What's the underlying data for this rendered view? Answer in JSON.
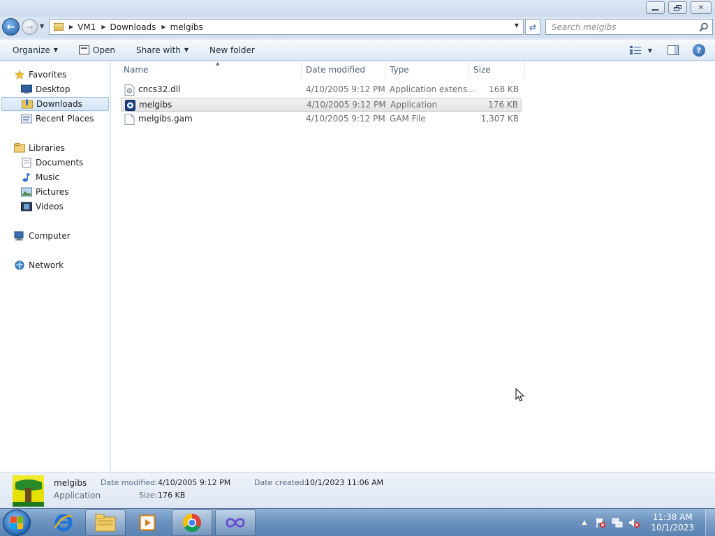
{
  "window": {
    "minimize_glyph": "▭",
    "maximize_glyph": "❐",
    "close_glyph": "✕"
  },
  "address": {
    "crumbs": [
      "VM1",
      "Downloads",
      "melgibs"
    ]
  },
  "search": {
    "placeholder": "Search melgibs"
  },
  "toolbar": {
    "organize": "Organize",
    "open": "Open",
    "share_with": "Share with",
    "new_folder": "New folder"
  },
  "nav": {
    "favorites": "Favorites",
    "desktop": "Desktop",
    "downloads": "Downloads",
    "recent_places": "Recent Places",
    "libraries": "Libraries",
    "documents": "Documents",
    "music": "Music",
    "pictures": "Pictures",
    "videos": "Videos",
    "computer": "Computer",
    "network": "Network"
  },
  "columns": {
    "name": "Name",
    "date_modified": "Date modified",
    "type": "Type",
    "size": "Size"
  },
  "files": [
    {
      "name": "cncs32.dll",
      "date": "4/10/2005 9:12 PM",
      "type": "Application extens...",
      "size": "168 KB",
      "icon": "dll-file-icon"
    },
    {
      "name": "melgibs",
      "date": "4/10/2005 9:12 PM",
      "type": "Application",
      "size": "176 KB",
      "icon": "application-icon"
    },
    {
      "name": "melgibs.gam",
      "date": "4/10/2005 9:12 PM",
      "type": "GAM File",
      "size": "1,307 KB",
      "icon": "generic-file-icon"
    }
  ],
  "details": {
    "name": "melgibs",
    "type": "Application",
    "date_modified_label": "Date modified:",
    "date_modified_value": "4/10/2005 9:12 PM",
    "date_created_label": "Date created:",
    "date_created_value": "10/1/2023 11:06 AM",
    "size_label": "Size:",
    "size_value": "176 KB"
  },
  "taskbar": {
    "time": "11:38 AM",
    "date": "10/1/2023"
  },
  "colors": {
    "accent": "#3c7fd2",
    "selection": "#d4e5f7",
    "taskbar": "#6d93bf"
  }
}
